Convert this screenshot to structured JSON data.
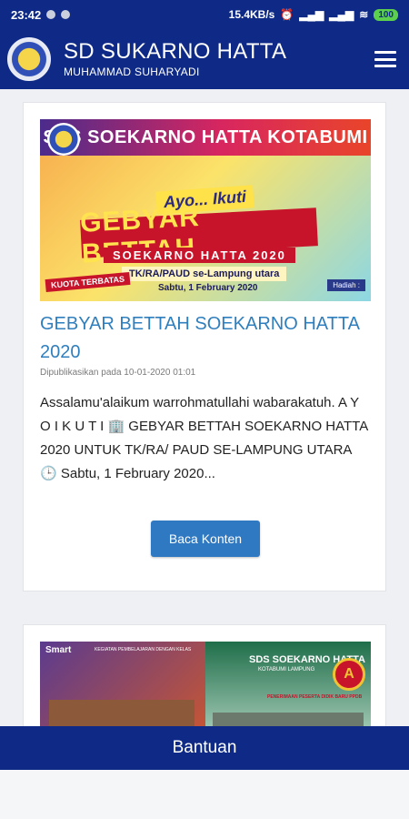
{
  "status_bar": {
    "time": "23:42",
    "net_speed": "15.4KB/s",
    "battery": "100"
  },
  "header": {
    "title": "SD SUKARNO HATTA",
    "subtitle": "MUHAMMAD SUHARYADI"
  },
  "posts": [
    {
      "banner": {
        "strip": "SDS SOEKARNO HATTA KOTABUMI",
        "ayo": "Ayo... Ikuti",
        "main": "GEBYAR BETTAH",
        "sub": "SOEKARNO HATTA 2020",
        "info": "TK/RA/PAUD se-Lampung utara",
        "date": "Sabtu, 1 February 2020",
        "kuota": "KUOTA TERBATAS",
        "hadiah": "Hadiah :"
      },
      "title": "GEBYAR BETTAH SOEKARNO HATTA 2020",
      "date": "Dipublikasikan pada 10-01-2020 01:01",
      "excerpt": "Assalamu'alaikum warrohmatullahi wabarakatuh. A Y O I K U T I 🏢 GEBYAR BETTAH SOEKARNO HATTA 2020 UNTUK TK/RA/ PAUD SE-LAMPUNG UTARA 🕒 Sabtu, 1 February 2020...",
      "button": "Baca Konten"
    },
    {
      "banner": {
        "smart": "Smart",
        "tag": "KEGIATAN PEMBELAJARAN DENGAN KELAS",
        "title": "SDS SOEKARNO HATTA",
        "subtitle": "KOTABUMI LAMPUNG",
        "ppdb": "PENERIMAAN PESERTA DIDIK BARU PPDB",
        "akreditasi": "A"
      }
    }
  ],
  "bottom_bar": {
    "label": "Bantuan"
  },
  "colors": {
    "primary": "#0e2a86",
    "link": "#2f7fbe",
    "button": "#2f78c2"
  }
}
